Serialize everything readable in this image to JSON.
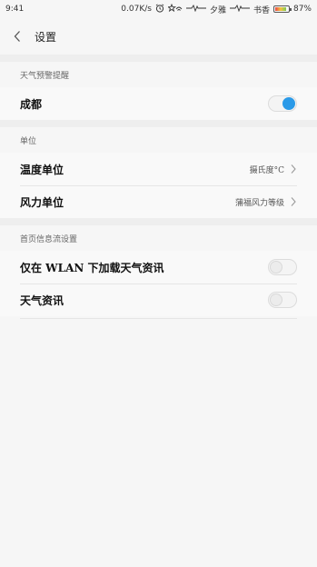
{
  "status_bar": {
    "time": "9:41",
    "speed": "0.07K/s",
    "carrier1": "夕雅",
    "carrier2": "书香",
    "battery": "87%",
    "battery_level": 0.87
  },
  "header": {
    "title": "设置"
  },
  "sections": {
    "weather_alert": {
      "title": "天气预警提醒",
      "rows": [
        {
          "label": "成都",
          "toggle": true
        }
      ]
    },
    "units": {
      "title": "单位",
      "rows": [
        {
          "label": "温度单位",
          "value": "摄氏度°C"
        },
        {
          "label": "风力单位",
          "value": "蒲福风力等级"
        }
      ]
    },
    "feed": {
      "title": "首页信息流设置",
      "rows": [
        {
          "label": "仅在 WLAN 下加载天气资讯",
          "toggle": false
        },
        {
          "label": "天气资讯",
          "toggle": false
        }
      ]
    }
  },
  "colors": {
    "accent": "#2b9ae8",
    "background": "#f6f6f6"
  }
}
